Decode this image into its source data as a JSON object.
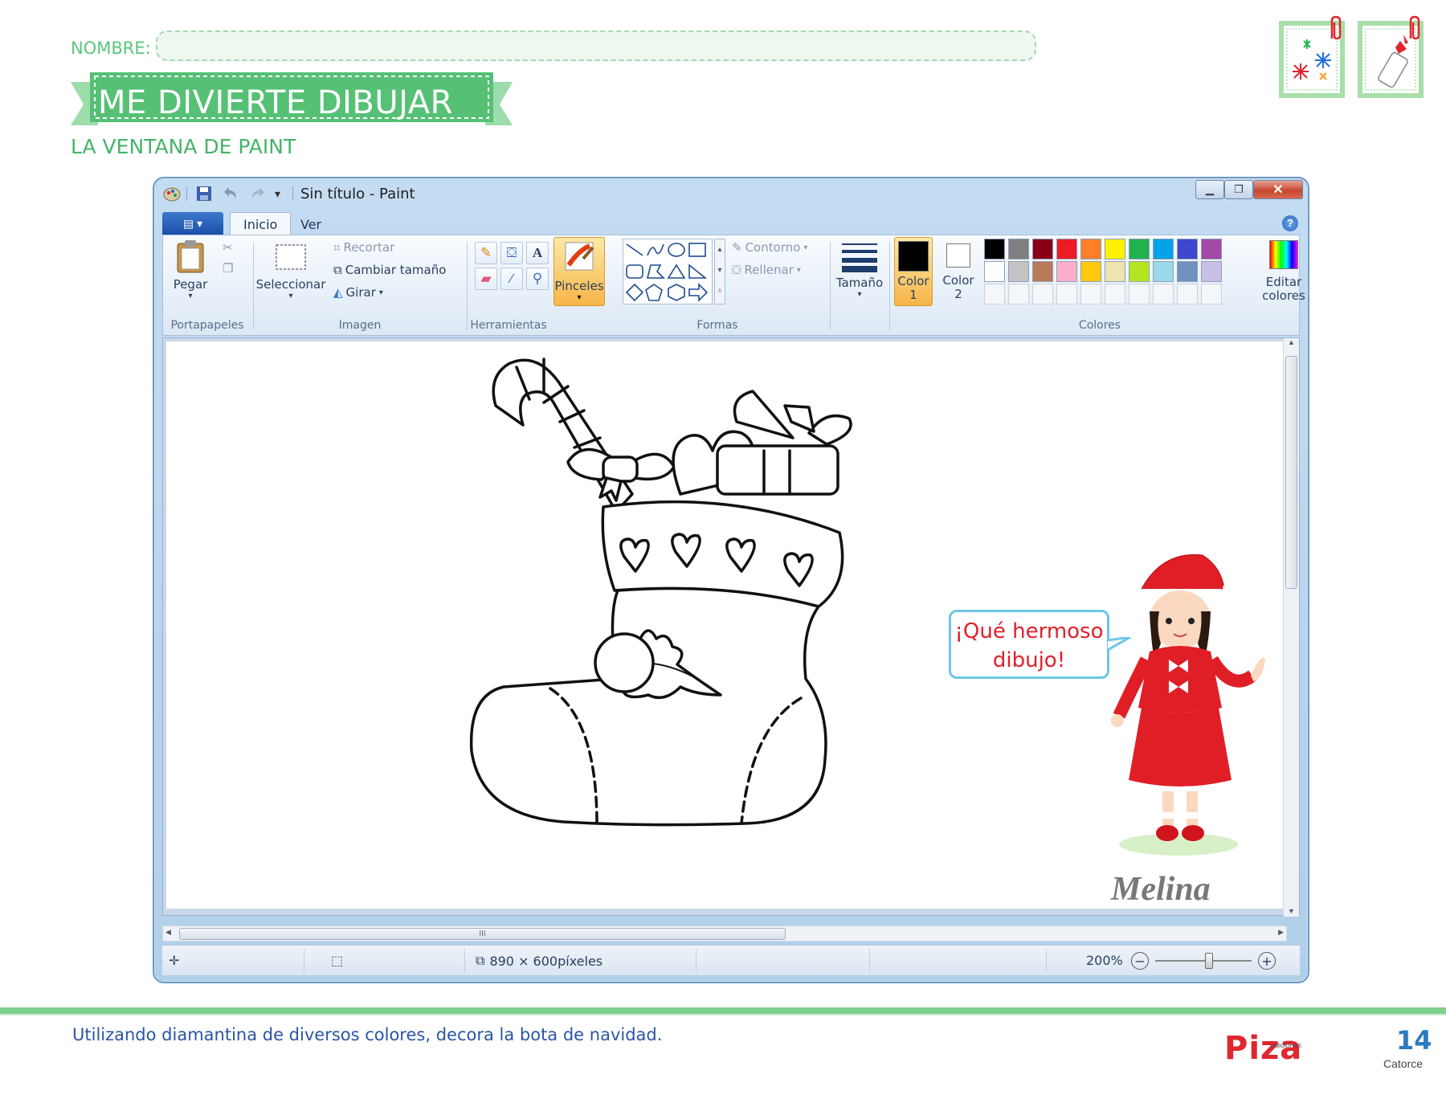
{
  "header": {
    "name_label": "NOMBRE:",
    "title": "ME DIVIERTE DIBUJAR",
    "subtitle": "LA VENTANA DE PAINT"
  },
  "paint": {
    "window_title": "Sin título - Paint",
    "tabs": [
      "Inicio",
      "Ver"
    ],
    "active_tab": "Inicio",
    "ribbon": {
      "clipboard": {
        "paste": "Pegar",
        "group": "Portapapeles"
      },
      "image": {
        "select": "Seleccionar",
        "crop": "Recortar",
        "resize": "Cambiar tamaño",
        "rotate": "Girar",
        "group": "Imagen"
      },
      "tools": {
        "group": "Herramientas"
      },
      "brushes": {
        "label": "Pinceles"
      },
      "shapes": {
        "outline": "Contorno",
        "fill": "Rellenar",
        "group": "Formas"
      },
      "size": {
        "label": "Tamaño"
      },
      "colors": {
        "color1": [
          "Color",
          "1"
        ],
        "color2": [
          "Color",
          "2"
        ],
        "edit": [
          "Editar",
          "colores"
        ],
        "group": "Colores",
        "color1_value": "#000000",
        "color2_value": "#ffffff",
        "palette_row1": [
          "#000000",
          "#7f7f7f",
          "#880015",
          "#ed1c24",
          "#ff7f27",
          "#fff200",
          "#22b14c",
          "#00a2e8",
          "#3f48cc",
          "#a349a4"
        ],
        "palette_row2": [
          "#ffffff",
          "#c3c3c3",
          "#b97a57",
          "#ffaec9",
          "#ffc90e",
          "#efe4b0",
          "#b5e61d",
          "#99d9ea",
          "#7092be",
          "#c8bfe7"
        ]
      }
    },
    "statusbar": {
      "dimensions": "890 × 600píxeles",
      "zoom": "200%"
    },
    "speech": {
      "line1": "¡Qué hermoso",
      "line2": "dibujo!"
    },
    "character_name": "Melina"
  },
  "footer": {
    "instruction": "Utilizando diamantina de diversos colores, decora la bota de navidad.",
    "publisher": "Piza",
    "publisher_small": "ediciones",
    "page_number": "14",
    "page_word": "Catorce"
  }
}
